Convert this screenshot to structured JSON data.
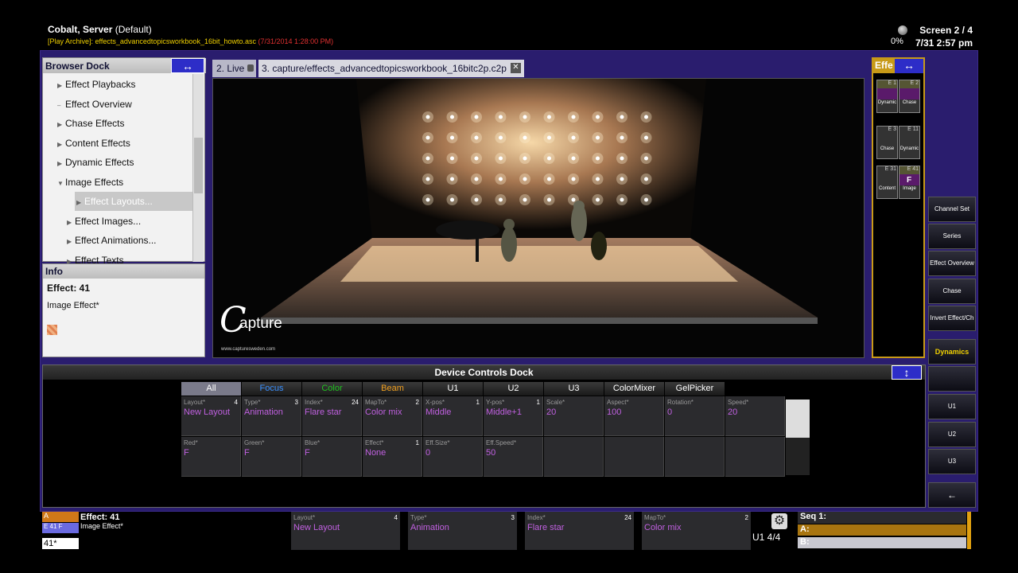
{
  "header": {
    "title": "Cobalt, Server",
    "title_suffix": "(Default)",
    "archive": "[Play Archive]: effects_advancedtopicsworkbook_16bit_howto.asc",
    "archive_time": "(7/31/2014 1:28:00 PM)",
    "screen": "Screen 2 / 4",
    "cpu": "0%",
    "datetime": "7/31 2:57 pm"
  },
  "browser": {
    "title": "Browser Dock",
    "swap": "↔",
    "items": [
      {
        "label": "Effect Playbacks",
        "arrow": "▶"
      },
      {
        "label": "Effect Overview",
        "arrow": "–"
      },
      {
        "label": "Chase Effects",
        "arrow": "▶"
      },
      {
        "label": "Content Effects",
        "arrow": "▶"
      },
      {
        "label": "Dynamic Effects",
        "arrow": "▶"
      },
      {
        "label": "Image Effects",
        "arrow": "▼"
      },
      {
        "label": "Effect Layouts...",
        "arrow": "▶"
      },
      {
        "label": "Effect Images...",
        "arrow": "▶"
      },
      {
        "label": "Effect Animations...",
        "arrow": "▶"
      },
      {
        "label": "Effect Texts",
        "arrow": "▶"
      }
    ]
  },
  "info": {
    "title": "Info",
    "effect": "Effect: 41",
    "sub": "Image Effect*"
  },
  "tabs": {
    "live": "2. Live",
    "capture": "3. capture/effects_advancedtopicsworkbook_16bitc2p.c2p",
    "close": "✕"
  },
  "viewport": {
    "logo_c": "C",
    "logo_text": "apture",
    "logo_url": "www.capturesweden.com"
  },
  "effects_panel": {
    "title": "Effe",
    "swap": "↔",
    "tiles": [
      {
        "num": "E 1",
        "label": "Dynamic"
      },
      {
        "num": "E 2",
        "label": "Chase"
      },
      {
        "num": "E 3",
        "label": "Chase"
      },
      {
        "num": "E 11",
        "label": "Dynamic"
      },
      {
        "num": "E 31",
        "label": "Content"
      },
      {
        "num": "E 41",
        "label": "Image",
        "mark": "F"
      }
    ]
  },
  "right_buttons": [
    {
      "label": "Channel Set"
    },
    {
      "label": "Series"
    },
    {
      "label": "Effect Overview"
    },
    {
      "label": "Chase"
    },
    {
      "label": "Invert Effect/Ch"
    },
    {
      "label": "Dynamics"
    },
    {
      "label": ""
    },
    {
      "label": "U1"
    },
    {
      "label": "U2"
    },
    {
      "label": "U3"
    },
    {
      "label": "←"
    }
  ],
  "device_controls": {
    "title": "Device Controls Dock",
    "swap": "↕",
    "tabs": [
      {
        "label": "All",
        "color": "#ffffff"
      },
      {
        "label": "Focus",
        "color": "#3a90ff"
      },
      {
        "label": "Color",
        "color": "#20c020"
      },
      {
        "label": "Beam",
        "color": "#f0a020"
      },
      {
        "label": "U1",
        "color": "#ffffff"
      },
      {
        "label": "U2",
        "color": "#ffffff"
      },
      {
        "label": "U3",
        "color": "#ffffff"
      },
      {
        "label": "ColorMixer",
        "color": "#ffffff"
      },
      {
        "label": "GelPicker",
        "color": "#ffffff"
      }
    ],
    "row1": [
      {
        "label": "Layout*",
        "num": "4",
        "value": "New Layout"
      },
      {
        "label": "Type*",
        "num": "3",
        "value": "Animation"
      },
      {
        "label": "Index*",
        "num": "24",
        "value": "Flare star"
      },
      {
        "label": "MapTo*",
        "num": "2",
        "value": "Color mix"
      },
      {
        "label": "X-pos*",
        "num": "1",
        "value": "Middle"
      },
      {
        "label": "Y-pos*",
        "num": "1",
        "value": "Middle+1"
      },
      {
        "label": "Scale*",
        "num": "",
        "value": "20"
      },
      {
        "label": "Aspect*",
        "num": "",
        "value": "100"
      },
      {
        "label": "Rotation*",
        "num": "",
        "value": "0"
      },
      {
        "label": "Speed*",
        "num": "",
        "value": "20"
      }
    ],
    "row2": [
      {
        "label": "Red*",
        "num": "",
        "value": "F"
      },
      {
        "label": "Green*",
        "num": "",
        "value": "F"
      },
      {
        "label": "Blue*",
        "num": "",
        "value": "F"
      },
      {
        "label": "Effect*",
        "num": "1",
        "value": "None"
      },
      {
        "label": "Eff.Size*",
        "num": "",
        "value": "0"
      },
      {
        "label": "Eff.Speed*",
        "num": "",
        "value": "50"
      },
      {
        "label": "",
        "num": "",
        "value": ""
      },
      {
        "label": "",
        "num": "",
        "value": ""
      },
      {
        "label": "",
        "num": "",
        "value": ""
      },
      {
        "label": "",
        "num": "",
        "value": ""
      }
    ]
  },
  "bottom": {
    "sel_a": "A",
    "sel_b": "E 41 F",
    "effect": "Effect: 41",
    "effect_sub": "Image Effect*",
    "command": "41*",
    "cells": [
      {
        "label": "Layout*",
        "num": "4",
        "value": "New Layout"
      },
      {
        "label": "Type*",
        "num": "3",
        "value": "Animation"
      },
      {
        "label": "Index*",
        "num": "24",
        "value": "Flare star"
      },
      {
        "label": "MapTo*",
        "num": "2",
        "value": "Color mix"
      }
    ],
    "page": "U1 4/4",
    "seq_title": "Seq 1:",
    "seq_a": "A:",
    "seq_b": "B:"
  }
}
